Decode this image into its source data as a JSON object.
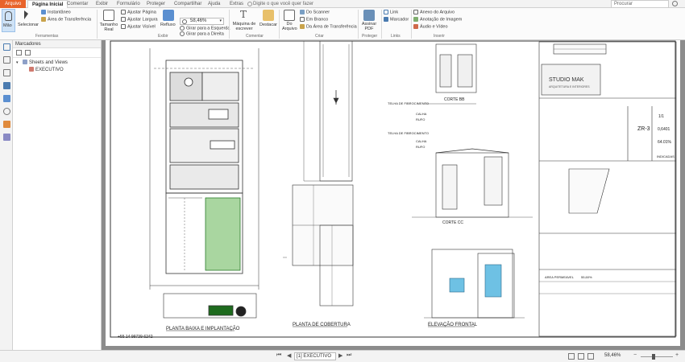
{
  "tabs": {
    "file": "Arquivo",
    "items": [
      "Página Inicial",
      "Comentar",
      "Exibir",
      "Formulário",
      "Proteger",
      "Compartilhar",
      "Ajuda",
      "Extras"
    ],
    "tellme": "Digite o que você quer fazer",
    "search_placeholder": "Procurar"
  },
  "ribbon": {
    "tools": {
      "hand": "Mão",
      "select": "Selecionar",
      "snapshot": "Instantâneo",
      "clipboard": "Área de Transferência",
      "label": "Ferramentas"
    },
    "view": {
      "actual_size": "Tamanho Real",
      "fit_page": "Ajustar Página",
      "fit_width": "Ajustar Largura",
      "fit_visible": "Ajustar Visível",
      "reflow": "Refluxo",
      "zoom": "58,46%",
      "rotate_left": "Girar para a Esquerda",
      "rotate_right": "Girar para a Direita",
      "label": "Exibir"
    },
    "comment": {
      "typewriter": "Máquina de escrever",
      "highlight": "Destacar",
      "label": "Comentar"
    },
    "create": {
      "from_file": "Do Arquivo",
      "from_scanner": "Do Scanner",
      "blank": "Em Branco",
      "from_clipboard": "Da Área de Transferência",
      "label": "Criar"
    },
    "protect": {
      "sign": "Assinar PDF",
      "label": "Proteger"
    },
    "links": {
      "link": "Link",
      "bookmark": "Marcador",
      "label": "Links"
    },
    "insert": {
      "attachment": "Anexo do Arquivo",
      "image": "Anotação de Imagem",
      "media": "Áudio e Vídeo",
      "label": "Inserir"
    }
  },
  "panel": {
    "title": "Marcadores",
    "items": [
      "Sheets and Views",
      "EXECUTIVO"
    ]
  },
  "drawing": {
    "title_ground": "PLANTA BAIXA E IMPLANTAÇÃO",
    "title_roof": "PLANTA DE COBERTURA",
    "title_facade": "ELEVAÇÃO FRONTAL",
    "cut_bb": "CORTE BB",
    "cut_cc": "CORTE CC",
    "phone": "+55 14 99739-6242",
    "studio": "STUDIO MAK",
    "studio_sub": "ARQUITETURA E INTERIORES",
    "roof_label_1": "TELHA DE FIBROCIMENTO",
    "calha": "CALHA",
    "rufo": "RUFO",
    "zone": "ZR-3",
    "pages": "1/1",
    "ratio1": "0,6401",
    "ratio2": "64.01%",
    "scale": "INDICADAS",
    "area_lote": "55,60%",
    "room_area": "AREA PERMEAVEL"
  },
  "status": {
    "page": "[1] EXECUTIVO",
    "zoom": "58,46%"
  }
}
